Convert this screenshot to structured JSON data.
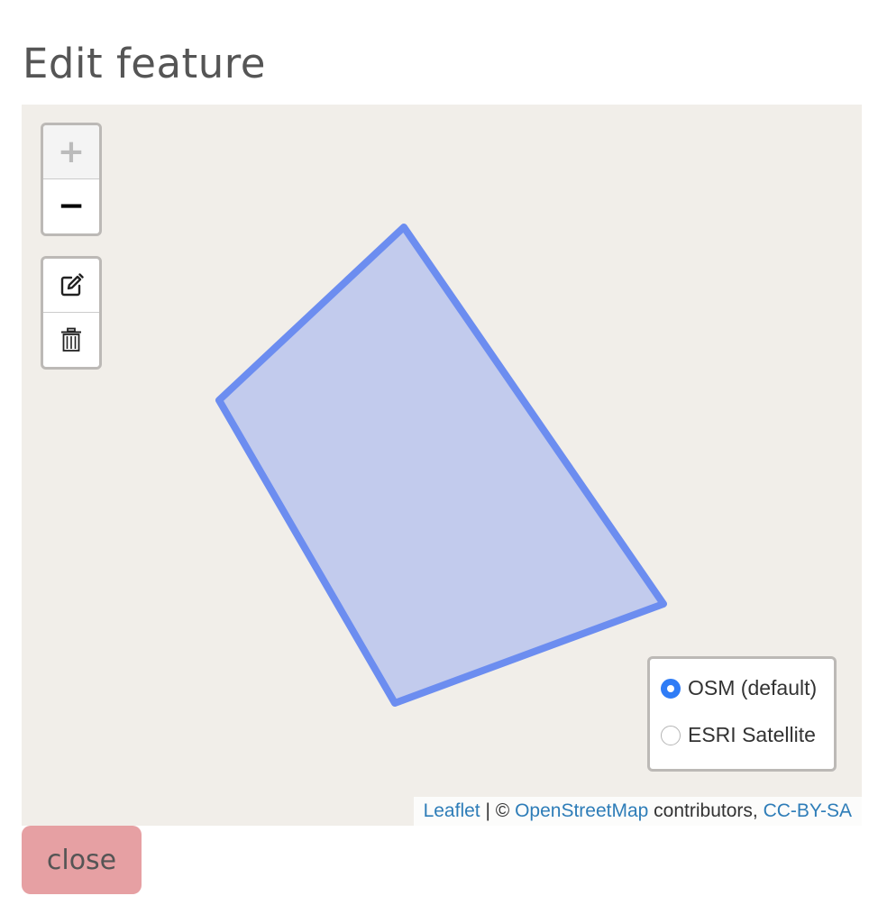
{
  "page": {
    "title": "Edit feature"
  },
  "map": {
    "zoom_in_label": "+",
    "zoom_out_label": "−",
    "feature_style": {
      "stroke_color": "#6c8df0",
      "fill_color": "#c2cbed"
    },
    "layers": [
      {
        "label": "OSM (default)",
        "selected": true
      },
      {
        "label": "ESRI Satellite",
        "selected": false
      }
    ],
    "attribution": {
      "leaflet": "Leaflet",
      "separator": " | © ",
      "osm": "OpenStreetMap",
      "contributors": " contributors, ",
      "license": "CC-BY-SA"
    }
  },
  "actions": {
    "close_label": "close"
  }
}
